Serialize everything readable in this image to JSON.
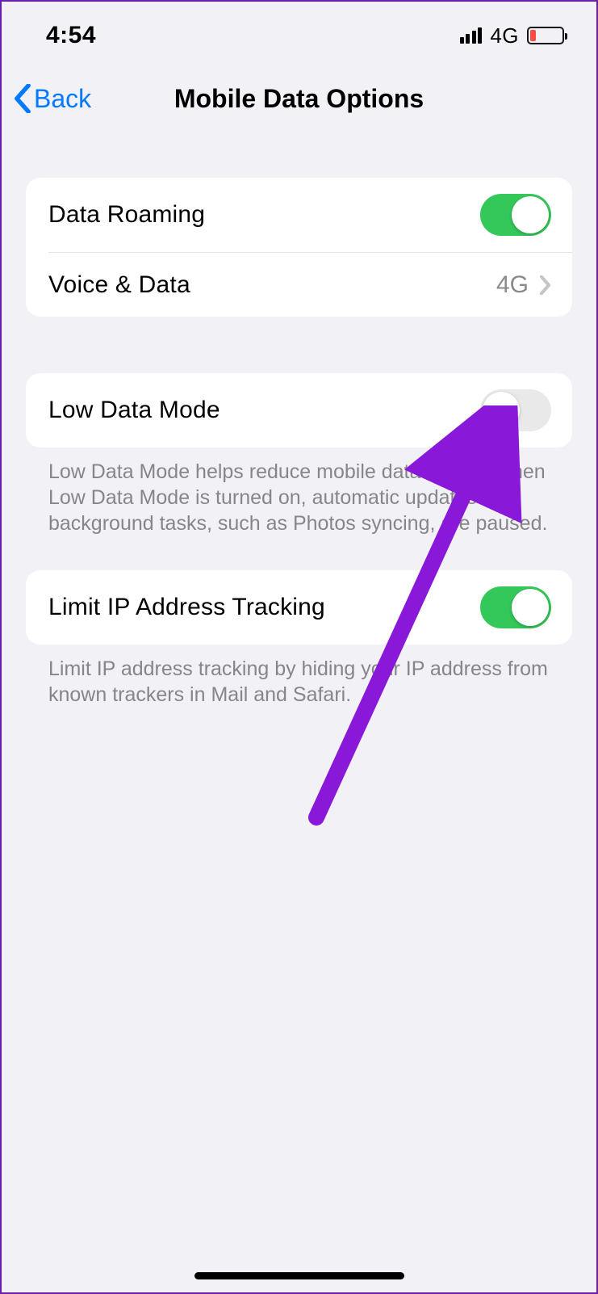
{
  "status": {
    "time": "4:54",
    "network": "4G"
  },
  "nav": {
    "back": "Back",
    "title": "Mobile Data Options"
  },
  "rows": {
    "data_roaming": {
      "label": "Data Roaming",
      "on": true
    },
    "voice_data": {
      "label": "Voice & Data",
      "value": "4G"
    },
    "low_data": {
      "label": "Low Data Mode",
      "on": false
    },
    "ip_track": {
      "label": "Limit IP Address Tracking",
      "on": true
    }
  },
  "footers": {
    "low_data": "Low Data Mode helps reduce mobile data usage. When Low Data Mode is turned on, automatic updates and background tasks, such as Photos syncing, are paused.",
    "ip_track": "Limit IP address tracking by hiding your IP address from known trackers in Mail and Safari."
  },
  "annotation": {
    "arrow_color": "#8a18d8"
  }
}
